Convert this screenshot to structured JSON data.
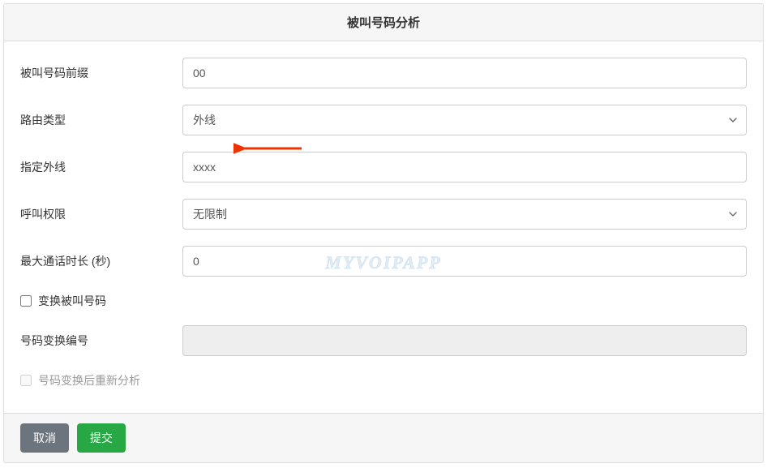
{
  "header": {
    "title": "被叫号码分析"
  },
  "form": {
    "prefix": {
      "label": "被叫号码前缀",
      "value": "00"
    },
    "routeType": {
      "label": "路由类型",
      "selected": "外线"
    },
    "specifiedLine": {
      "label": "指定外线",
      "value": "xxxx"
    },
    "callPermission": {
      "label": "呼叫权限",
      "selected": "无限制"
    },
    "maxDuration": {
      "label": "最大通话时长 (秒)",
      "value": "0"
    },
    "transformCallee": {
      "label": "变换被叫号码"
    },
    "transformNumber": {
      "label": "号码变换编号",
      "value": ""
    },
    "reanalyze": {
      "label": "号码变换后重新分析"
    }
  },
  "footer": {
    "cancel": "取消",
    "submit": "提交"
  },
  "watermark": "MYVOIPAPP"
}
